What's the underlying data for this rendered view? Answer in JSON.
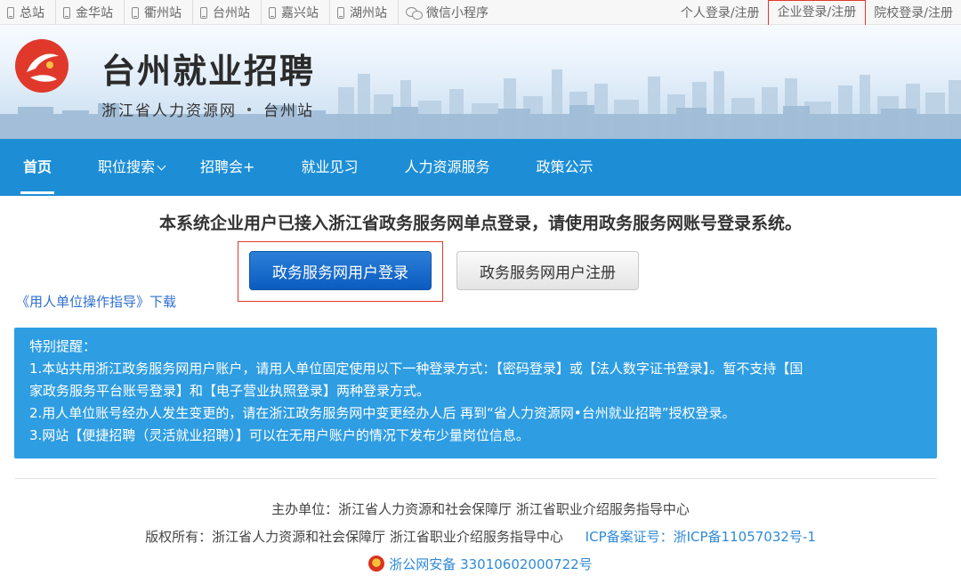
{
  "topbar": {
    "sites": [
      "总站",
      "金华站",
      "衢州站",
      "台州站",
      "嘉兴站",
      "湖州站"
    ],
    "wechat": "微信小程序",
    "logins": {
      "personal": "个人登录/注册",
      "enterprise": "企业登录/注册",
      "school": "院校登录/注册"
    }
  },
  "banner": {
    "title": "台州就业招聘",
    "subtitle_left": "浙江省人力资源网",
    "subtitle_right": "台州站"
  },
  "nav": {
    "items": [
      "首页",
      "职位搜索",
      "招聘会+",
      "就业见习",
      "人力资源服务",
      "政策公示"
    ]
  },
  "main": {
    "notice": "本系统企业用户已接入浙江省政务服务网单点登录，请使用政务服务网账号登录系统。",
    "login_button": "政务服务网用户登录",
    "register_button": "政务服务网用户注册",
    "guide_link": "《用人单位操作指导》下载",
    "tips": {
      "title": "特别提醒：",
      "line1": "1.本站共用浙江政务服务网用户账户，请用人单位固定使用以下一种登录方式：【密码登录】或【法人数字证书登录】。暂不支持【国",
      "line1b": "家政务服务平台账号登录】和【电子营业执照登录】两种登录方式。",
      "line2": "2.用人单位账号经办人发生变更的，请在浙江政务服务网中变更经办人后 再到“省人力资源网•台州就业招聘”授权登录。",
      "line3": "3.网站【便捷招聘（灵活就业招聘）】可以在无用户账户的情况下发布少量岗位信息。"
    }
  },
  "footer": {
    "sponsor": "主办单位：浙江省人力资源和社会保障厅 浙江省职业介绍服务指导中心",
    "copyright": "版权所有：浙江省人力资源和社会保障厅 浙江省职业介绍服务指导中心",
    "icp": "ICP备案证号：浙ICP备11057032号-1",
    "police": "浙公网安备 33010602000722号"
  },
  "colors": {
    "nav_bg": "#1d8ed6",
    "tips_bg": "#2e9de2",
    "login_button": "#0b5cc0",
    "highlight_border": "#e0392b",
    "link": "#2f6fd0"
  },
  "icons": [
    "phone-icon",
    "wechat-icon",
    "logo-emblem",
    "chevron-down-icon",
    "police-badge-icon"
  ]
}
